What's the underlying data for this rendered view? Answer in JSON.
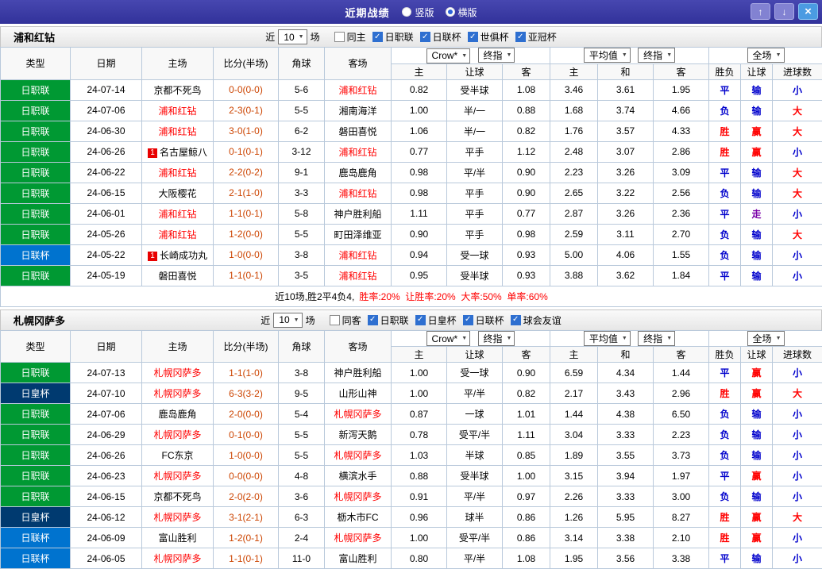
{
  "titlebar": {
    "title": "近期战绩",
    "radios": [
      {
        "name": "vertical",
        "label": "竖版",
        "selected": false
      },
      {
        "name": "horizontal",
        "label": "横版",
        "selected": true
      }
    ]
  },
  "icons": {
    "up_arrow": "↑",
    "down_arrow": "↓",
    "close": "×",
    "select_arrow": "▼",
    "check": "✓"
  },
  "labels": {
    "near": "近",
    "games": "场"
  },
  "dropdowns": {
    "bookmaker": "Crow*",
    "final": "终指",
    "average": "平均值",
    "fulltime": "全场"
  },
  "columns": {
    "type": "类型",
    "date": "日期",
    "home": "主场",
    "score": "比分(半场)",
    "corner": "角球",
    "away": "客场",
    "asia": [
      "主",
      "让球",
      "客"
    ],
    "europe": [
      "主",
      "和",
      "客"
    ],
    "result": [
      "胜负",
      "让球",
      "进球数"
    ]
  },
  "colors": {
    "titlebar_bg": "#32329a",
    "titlebar_button_bg": "#8282d2",
    "close_button_bg": "#4b9be2",
    "table_border": "#b9c9db",
    "focus_team": "#ff0000",
    "score": "#cc4400",
    "badge_bg": "#e80000",
    "summary_red": "#ff0000",
    "checkbox_checked": "#2e6fd0",
    "radio_dot": "#2d62d8",
    "type": {
      "日职联": "#009933",
      "日联杯": "#0073cf",
      "日皇杯": "#003a70"
    },
    "result_map": {
      "胜": "#ff0000",
      "平": "#0000cc",
      "负": "#0000cc",
      "赢": "#ff0000",
      "输": "#0000cc",
      "走": "#7a00a8",
      "大": "#ff0000",
      "小": "#0000cc"
    }
  },
  "sections": [
    {
      "team": "浦和红钻",
      "near_count": "10",
      "checkboxes": [
        {
          "name": "same-home",
          "label": "同主",
          "checked": false
        },
        {
          "name": "j1-league",
          "label": "日职联",
          "checked": true
        },
        {
          "name": "league-cup",
          "label": "日联杯",
          "checked": true
        },
        {
          "name": "club-world-cup",
          "label": "世俱杯",
          "checked": true
        },
        {
          "name": "acl",
          "label": "亚冠杯",
          "checked": true
        }
      ],
      "rows": [
        {
          "type": "日职联",
          "date": "24-07-14",
          "home": "京都不死鸟",
          "home_focus": false,
          "home_badge": "",
          "score": "0-0(0-0)",
          "corner": "5-6",
          "away": "浦和红钻",
          "away_focus": true,
          "asia": [
            "0.82",
            "受半球",
            "1.08"
          ],
          "europe": [
            "3.46",
            "3.61",
            "1.95"
          ],
          "result": [
            "平",
            "输",
            "小"
          ]
        },
        {
          "type": "日职联",
          "date": "24-07-06",
          "home": "浦和红钻",
          "home_focus": true,
          "home_badge": "",
          "score": "2-3(0-1)",
          "corner": "5-5",
          "away": "湘南海洋",
          "away_focus": false,
          "asia": [
            "1.00",
            "半/一",
            "0.88"
          ],
          "europe": [
            "1.68",
            "3.74",
            "4.66"
          ],
          "result": [
            "负",
            "输",
            "大"
          ]
        },
        {
          "type": "日职联",
          "date": "24-06-30",
          "home": "浦和红钻",
          "home_focus": true,
          "home_badge": "",
          "score": "3-0(1-0)",
          "corner": "6-2",
          "away": "磐田喜悦",
          "away_focus": false,
          "asia": [
            "1.06",
            "半/一",
            "0.82"
          ],
          "europe": [
            "1.76",
            "3.57",
            "4.33"
          ],
          "result": [
            "胜",
            "赢",
            "大"
          ]
        },
        {
          "type": "日职联",
          "date": "24-06-26",
          "home": "名古屋鲸八",
          "home_focus": false,
          "home_badge": "1",
          "score": "0-1(0-1)",
          "corner": "3-12",
          "away": "浦和红钻",
          "away_focus": true,
          "asia": [
            "0.77",
            "平手",
            "1.12"
          ],
          "europe": [
            "2.48",
            "3.07",
            "2.86"
          ],
          "result": [
            "胜",
            "赢",
            "小"
          ]
        },
        {
          "type": "日职联",
          "date": "24-06-22",
          "home": "浦和红钻",
          "home_focus": true,
          "home_badge": "",
          "score": "2-2(0-2)",
          "corner": "9-1",
          "away": "鹿岛鹿角",
          "away_focus": false,
          "asia": [
            "0.98",
            "平/半",
            "0.90"
          ],
          "europe": [
            "2.23",
            "3.26",
            "3.09"
          ],
          "result": [
            "平",
            "输",
            "大"
          ]
        },
        {
          "type": "日职联",
          "date": "24-06-15",
          "home": "大阪樱花",
          "home_focus": false,
          "home_badge": "",
          "score": "2-1(1-0)",
          "corner": "3-3",
          "away": "浦和红钻",
          "away_focus": true,
          "asia": [
            "0.98",
            "平手",
            "0.90"
          ],
          "europe": [
            "2.65",
            "3.22",
            "2.56"
          ],
          "result": [
            "负",
            "输",
            "大"
          ]
        },
        {
          "type": "日职联",
          "date": "24-06-01",
          "home": "浦和红钻",
          "home_focus": true,
          "home_badge": "",
          "score": "1-1(0-1)",
          "corner": "5-8",
          "away": "神户胜利船",
          "away_focus": false,
          "asia": [
            "1.11",
            "平手",
            "0.77"
          ],
          "europe": [
            "2.87",
            "3.26",
            "2.36"
          ],
          "result": [
            "平",
            "走",
            "小"
          ]
        },
        {
          "type": "日职联",
          "date": "24-05-26",
          "home": "浦和红钻",
          "home_focus": true,
          "home_badge": "",
          "score": "1-2(0-0)",
          "corner": "5-5",
          "away": "町田泽维亚",
          "away_focus": false,
          "asia": [
            "0.90",
            "平手",
            "0.98"
          ],
          "europe": [
            "2.59",
            "3.11",
            "2.70"
          ],
          "result": [
            "负",
            "输",
            "大"
          ]
        },
        {
          "type": "日联杯",
          "date": "24-05-22",
          "home": "长崎成功丸",
          "home_focus": false,
          "home_badge": "1",
          "score": "1-0(0-0)",
          "corner": "3-8",
          "away": "浦和红钻",
          "away_focus": true,
          "asia": [
            "0.94",
            "受一球",
            "0.93"
          ],
          "europe": [
            "5.00",
            "4.06",
            "1.55"
          ],
          "result": [
            "负",
            "输",
            "小"
          ]
        },
        {
          "type": "日职联",
          "date": "24-05-19",
          "home": "磐田喜悦",
          "home_focus": false,
          "home_badge": "",
          "score": "1-1(0-1)",
          "corner": "3-5",
          "away": "浦和红钻",
          "away_focus": true,
          "asia": [
            "0.95",
            "受半球",
            "0.93"
          ],
          "europe": [
            "3.88",
            "3.62",
            "1.84"
          ],
          "result": [
            "平",
            "输",
            "小"
          ]
        }
      ],
      "summary": {
        "lead": "近10场,胜2平4负4,",
        "stats": "胜率:20%  让胜率:20%  大率:50%  单率:60%"
      }
    },
    {
      "team": "札幌冈萨多",
      "near_count": "10",
      "checkboxes": [
        {
          "name": "same-away",
          "label": "同客",
          "checked": false
        },
        {
          "name": "j1-league",
          "label": "日职联",
          "checked": true
        },
        {
          "name": "emperors-cup",
          "label": "日皇杯",
          "checked": true
        },
        {
          "name": "league-cup",
          "label": "日联杯",
          "checked": true
        },
        {
          "name": "club-friendly",
          "label": "球会友谊",
          "checked": true
        }
      ],
      "rows": [
        {
          "type": "日职联",
          "date": "24-07-13",
          "home": "札幌冈萨多",
          "home_focus": true,
          "home_badge": "",
          "score": "1-1(1-0)",
          "corner": "3-8",
          "away": "神户胜利船",
          "away_focus": false,
          "asia": [
            "1.00",
            "受一球",
            "0.90"
          ],
          "europe": [
            "6.59",
            "4.34",
            "1.44"
          ],
          "result": [
            "平",
            "赢",
            "小"
          ]
        },
        {
          "type": "日皇杯",
          "date": "24-07-10",
          "home": "札幌冈萨多",
          "home_focus": true,
          "home_badge": "",
          "score": "6-3(3-2)",
          "corner": "9-5",
          "away": "山形山神",
          "away_focus": false,
          "asia": [
            "1.00",
            "平/半",
            "0.82"
          ],
          "europe": [
            "2.17",
            "3.43",
            "2.96"
          ],
          "result": [
            "胜",
            "赢",
            "大"
          ]
        },
        {
          "type": "日职联",
          "date": "24-07-06",
          "home": "鹿岛鹿角",
          "home_focus": false,
          "home_badge": "",
          "score": "2-0(0-0)",
          "corner": "5-4",
          "away": "札幌冈萨多",
          "away_focus": true,
          "asia": [
            "0.87",
            "一球",
            "1.01"
          ],
          "europe": [
            "1.44",
            "4.38",
            "6.50"
          ],
          "result": [
            "负",
            "输",
            "小"
          ]
        },
        {
          "type": "日职联",
          "date": "24-06-29",
          "home": "札幌冈萨多",
          "home_focus": true,
          "home_badge": "",
          "score": "0-1(0-0)",
          "corner": "5-5",
          "away": "新泻天鹅",
          "away_focus": false,
          "asia": [
            "0.78",
            "受平/半",
            "1.11"
          ],
          "europe": [
            "3.04",
            "3.33",
            "2.23"
          ],
          "result": [
            "负",
            "输",
            "小"
          ]
        },
        {
          "type": "日职联",
          "date": "24-06-26",
          "home": "FC东京",
          "home_focus": false,
          "home_badge": "",
          "score": "1-0(0-0)",
          "corner": "5-5",
          "away": "札幌冈萨多",
          "away_focus": true,
          "asia": [
            "1.03",
            "半球",
            "0.85"
          ],
          "europe": [
            "1.89",
            "3.55",
            "3.73"
          ],
          "result": [
            "负",
            "输",
            "小"
          ]
        },
        {
          "type": "日职联",
          "date": "24-06-23",
          "home": "札幌冈萨多",
          "home_focus": true,
          "home_badge": "",
          "score": "0-0(0-0)",
          "corner": "4-8",
          "away": "横滨水手",
          "away_focus": false,
          "asia": [
            "0.88",
            "受半球",
            "1.00"
          ],
          "europe": [
            "3.15",
            "3.94",
            "1.97"
          ],
          "result": [
            "平",
            "赢",
            "小"
          ]
        },
        {
          "type": "日职联",
          "date": "24-06-15",
          "home": "京都不死鸟",
          "home_focus": false,
          "home_badge": "",
          "score": "2-0(2-0)",
          "corner": "3-6",
          "away": "札幌冈萨多",
          "away_focus": true,
          "asia": [
            "0.91",
            "平/半",
            "0.97"
          ],
          "europe": [
            "2.26",
            "3.33",
            "3.00"
          ],
          "result": [
            "负",
            "输",
            "小"
          ]
        },
        {
          "type": "日皇杯",
          "date": "24-06-12",
          "home": "札幌冈萨多",
          "home_focus": true,
          "home_badge": "",
          "score": "3-1(2-1)",
          "corner": "6-3",
          "away": "枥木市FC",
          "away_focus": false,
          "asia": [
            "0.96",
            "球半",
            "0.86"
          ],
          "europe": [
            "1.26",
            "5.95",
            "8.27"
          ],
          "result": [
            "胜",
            "赢",
            "大"
          ]
        },
        {
          "type": "日联杯",
          "date": "24-06-09",
          "home": "富山胜利",
          "home_focus": false,
          "home_badge": "",
          "score": "1-2(0-1)",
          "corner": "2-4",
          "away": "札幌冈萨多",
          "away_focus": true,
          "asia": [
            "1.00",
            "受平/半",
            "0.86"
          ],
          "europe": [
            "3.14",
            "3.38",
            "2.10"
          ],
          "result": [
            "胜",
            "赢",
            "小"
          ]
        },
        {
          "type": "日联杯",
          "date": "24-06-05",
          "home": "札幌冈萨多",
          "home_focus": true,
          "home_badge": "",
          "score": "1-1(0-1)",
          "corner": "11-0",
          "away": "富山胜利",
          "away_focus": false,
          "asia": [
            "0.80",
            "平/半",
            "1.08"
          ],
          "europe": [
            "1.95",
            "3.56",
            "3.38"
          ],
          "result": [
            "平",
            "输",
            "小"
          ]
        }
      ]
    }
  ]
}
